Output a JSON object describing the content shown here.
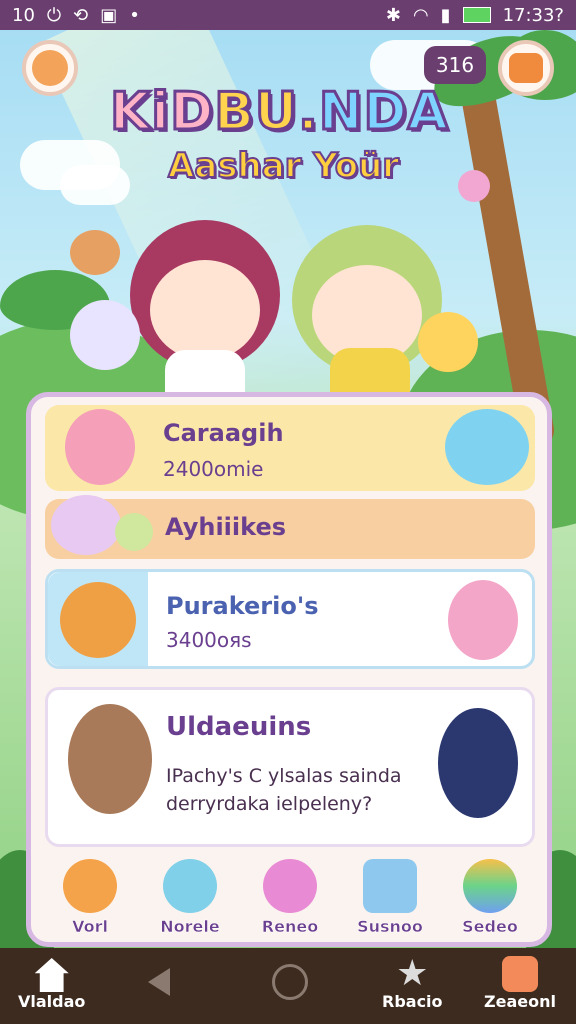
{
  "status_bar": {
    "time": "10",
    "right_text": "17:33?",
    "battery_color": "#5fd35f"
  },
  "header": {
    "coins": "316",
    "logo": [
      "KiD",
      "BU.",
      "NDA"
    ],
    "subtitle": "Aashar Yoür"
  },
  "cards": [
    {
      "title": "Caraagih",
      "subtitle": "2400omie",
      "bg": "#fbe7a8"
    },
    {
      "title": "Ayhiiikes",
      "subtitle": "",
      "bg": "#f8cfa0"
    },
    {
      "title": "Purakerio's",
      "subtitle": "3400oяs",
      "bg": "#ffffff"
    },
    {
      "title": "Uldaeuins",
      "desc_line1": "IPachy's C ylsalas sainda",
      "desc_line2": "derryrdaka ielpeleny?"
    }
  ],
  "bottom_nav": [
    {
      "label": "Vorl",
      "icon": "carrot-icon"
    },
    {
      "label": "Norele",
      "icon": "blue-creature-icon"
    },
    {
      "label": "Reneo",
      "icon": "pink-house-icon"
    },
    {
      "label": "Susnoo",
      "icon": "blue-box-icon"
    },
    {
      "label": "Sedeo",
      "icon": "rainbow-egg-icon"
    }
  ],
  "system_nav": {
    "home_label": "Vlaldao",
    "star_label": "Rbacio",
    "right_label": "Zeaeonl"
  }
}
